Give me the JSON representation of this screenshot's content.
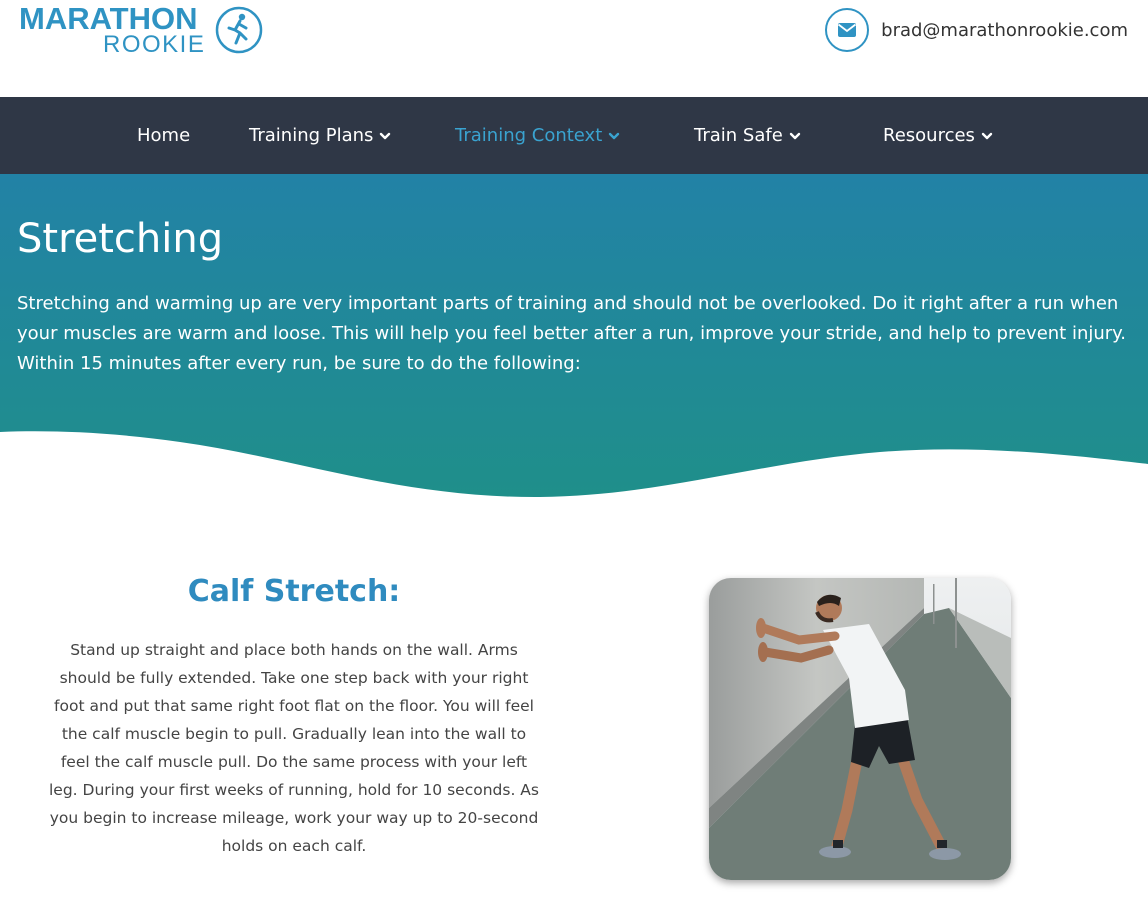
{
  "brand": {
    "name_line1": "MARATHON",
    "name_line2": "ROOKIE",
    "primary_color": "#2f93c3"
  },
  "contact": {
    "icon": "envelope-icon",
    "email": "brad@marathonrookie.com"
  },
  "nav": {
    "background": "#2f3746",
    "items": [
      {
        "label": "Home",
        "has_dropdown": false,
        "active": false
      },
      {
        "label": "Training Plans",
        "has_dropdown": true,
        "active": false
      },
      {
        "label": "Training Context",
        "has_dropdown": true,
        "active": true
      },
      {
        "label": "Train Safe",
        "has_dropdown": true,
        "active": false
      },
      {
        "label": "Resources",
        "has_dropdown": true,
        "active": false
      }
    ]
  },
  "hero": {
    "title": "Stretching",
    "text": "Stretching and warming up are very important parts of training and should not be overlooked. Do it right after a run when your muscles are warm and loose. This will help you feel better after a run, improve your stride, and help to prevent injury. Within 15 minutes after every run, be sure to do the following:",
    "gradient_top": "#2282a6",
    "gradient_bottom": "#1f8f8a"
  },
  "section": {
    "title": "Calf Stretch:",
    "body": "Stand up straight and place both hands on the wall. Arms should be fully extended. Take one step back with your right foot and put that same right foot flat on the floor. You will feel the calf muscle begin to pull. Gradually lean into the wall to feel the calf muscle pull. Do the same process with your left leg. During your first weeks of running, hold for 10 seconds. As you begin to increase mileage, work your way up to 20-second holds on each calf."
  }
}
